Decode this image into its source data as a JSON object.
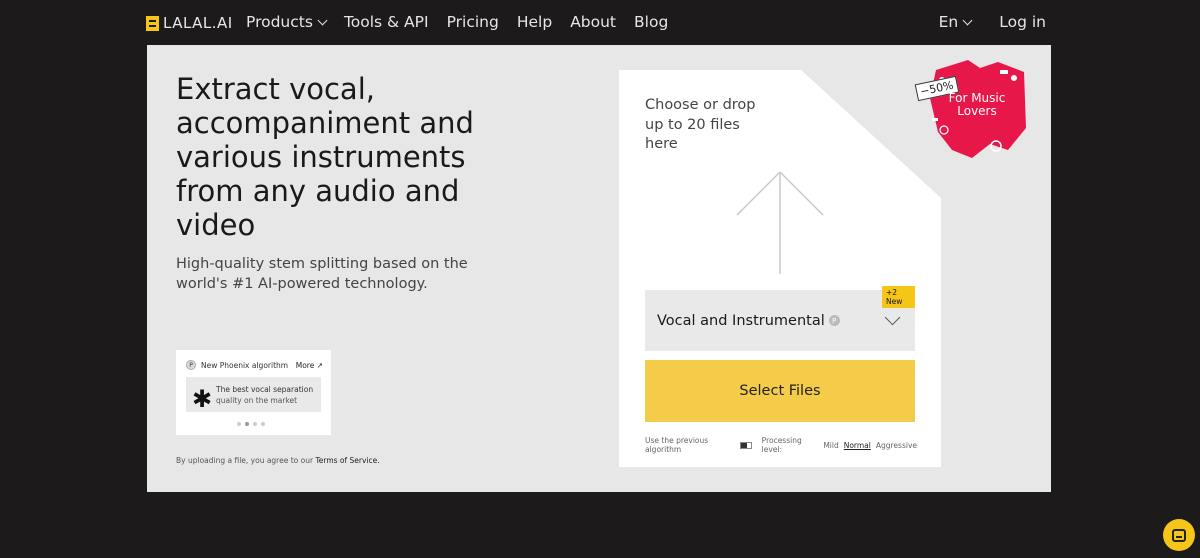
{
  "nav": {
    "logo_text": "LALAL.AI",
    "links": [
      {
        "label": "Products",
        "dropdown": true
      },
      {
        "label": "Tools & API"
      },
      {
        "label": "Pricing"
      },
      {
        "label": "Help"
      },
      {
        "label": "About"
      },
      {
        "label": "Blog"
      }
    ],
    "language": "En",
    "login": "Log in"
  },
  "hero": {
    "headline": "Extract vocal, accompaniment and various instruments from any audio and video",
    "subhead": "High-quality stem splitting based on the world's #1 AI-powered technology."
  },
  "promo": {
    "badge_icon": "P",
    "title": "New Phoenix algorithm",
    "more": "More ↗",
    "highlight": "The best vocal separation",
    "detail": "quality on the market",
    "slides": 4,
    "active_slide": 1
  },
  "tos": {
    "prefix": "By uploading a file, you agree to our",
    "link": "Terms of Service."
  },
  "upload": {
    "drop_text": "Choose or drop up to 20 files here",
    "separation_label": "Vocal and Instrumental",
    "separation_icon": "P",
    "new_badge": "+2 New",
    "select_button": "Select Files",
    "previous_algorithm": "Use the previous algorithm",
    "processing_label": "Processing level:",
    "levels": [
      "Mild",
      "Normal",
      "Aggressive"
    ],
    "selected_level": "Normal"
  },
  "sticker": {
    "discount": "−50%",
    "text": "For Music Lovers"
  },
  "colors": {
    "background": "#1c1a1b",
    "panel": "#e7e7e7",
    "accent_yellow": "#f5c518",
    "button_yellow": "#f5cc4a",
    "sticker_red": "#e8174a"
  }
}
